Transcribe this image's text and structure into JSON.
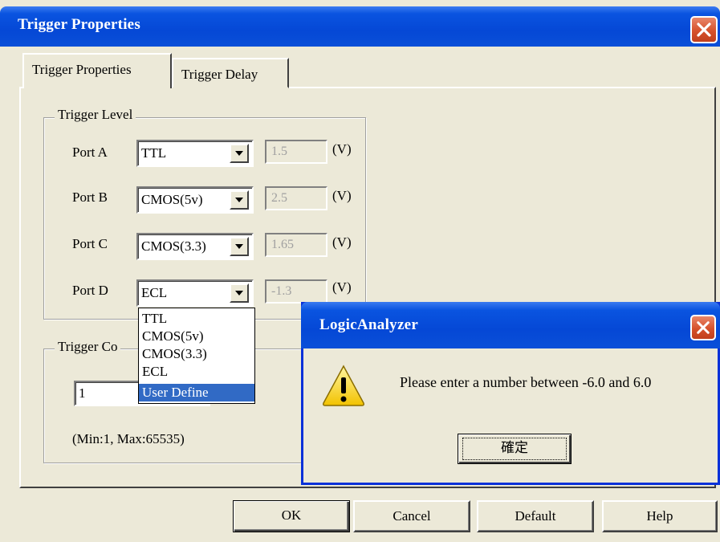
{
  "window": {
    "title": "Trigger Properties",
    "close_icon": "close-icon"
  },
  "tabs": [
    {
      "label": "Trigger Properties",
      "active": true
    },
    {
      "label": "Trigger Delay",
      "active": false
    }
  ],
  "trigger_level": {
    "label": "Trigger Level",
    "unit": "(V)",
    "ports": [
      {
        "label": "Port A",
        "selected": "TTL",
        "voltage": "1.5"
      },
      {
        "label": "Port B",
        "selected": "CMOS(5v)",
        "voltage": "2.5"
      },
      {
        "label": "Port C",
        "selected": "CMOS(3.3)",
        "voltage": "1.65"
      },
      {
        "label": "Port D",
        "selected": "ECL",
        "voltage": "-1.3"
      }
    ]
  },
  "dropdown": {
    "options": [
      "TTL",
      "CMOS(5v)",
      "CMOS(3.3)",
      "ECL",
      "User Define"
    ],
    "highlighted": "User Define"
  },
  "trigger_count": {
    "label": "Trigger Co",
    "value": "1",
    "range_text": "(Min:1, Max:65535)"
  },
  "buttons": {
    "ok": "OK",
    "cancel": "Cancel",
    "default": "Default",
    "help": "Help"
  },
  "message_box": {
    "title": "LogicAnalyzer",
    "message": "Please enter a number between -6.0 and 6.0",
    "ok_label": "確定",
    "icon": "warning-icon"
  },
  "colors": {
    "titlebar": "#0a54e0",
    "close_button": "#d6512b",
    "selection": "#316ac5",
    "face": "#ece9d8"
  }
}
